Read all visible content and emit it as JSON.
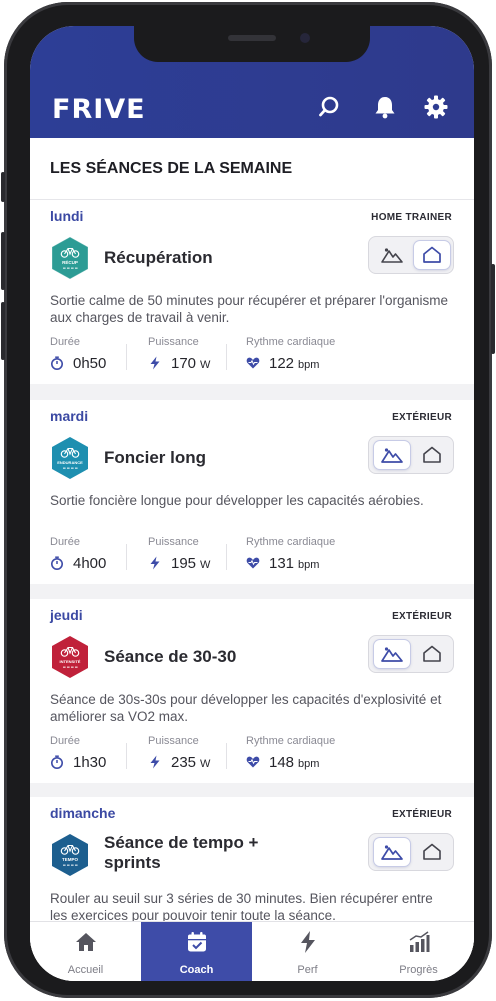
{
  "app": {
    "logo": "FRIVE",
    "accent": "#2e3d92"
  },
  "header_icons": [
    "search-icon",
    "bell-icon",
    "gear-icon"
  ],
  "section": {
    "title": "LES SÉANCES DE LA SEMAINE"
  },
  "stat_labels": {
    "duration": "Durée",
    "power": "Puissance",
    "heart": "Rythme cardiaque"
  },
  "units": {
    "power": "W",
    "heart": "bpm"
  },
  "sessions": [
    {
      "day": "lundi",
      "environment": "HOME TRAINER",
      "badge_label": "RÉCUP",
      "badge_color": "#2c9c95",
      "title": "Récupération",
      "selected_mode": "indoor",
      "description": "Sortie calme de 50 minutes pour récupérer et préparer l'organisme aux charges de travail à venir.",
      "duration": "0h50",
      "power": "170",
      "heart_rate": "122"
    },
    {
      "day": "mardi",
      "environment": "EXTÉRIEUR",
      "badge_label": "ENDURANCE",
      "badge_color": "#1e8fb0",
      "title": "Foncier long",
      "selected_mode": "outdoor",
      "description": "Sortie foncière longue pour développer les capacités aérobies.",
      "duration": "4h00",
      "power": "195",
      "heart_rate": "131"
    },
    {
      "day": "jeudi",
      "environment": "EXTÉRIEUR",
      "badge_label": "INTENSITÉ",
      "badge_color": "#c0213a",
      "title": "Séance de 30-30",
      "selected_mode": "outdoor",
      "description": "Séance de 30s-30s pour développer les capacités d'explosivité et améliorer sa VO2 max.",
      "duration": "1h30",
      "power": "235",
      "heart_rate": "148"
    },
    {
      "day": "dimanche",
      "environment": "EXTÉRIEUR",
      "badge_label": "TEMPO",
      "badge_color": "#1d5f8f",
      "title": "Séance de tempo + sprints",
      "selected_mode": "outdoor",
      "description": "Rouler au seuil sur 3 séries de 30 minutes. Bien récupérer entre les exercices pour pouvoir tenir toute la séance.",
      "duration": "",
      "power": "",
      "heart_rate": ""
    }
  ],
  "tabs": [
    {
      "label": "Accueil",
      "icon": "home-icon",
      "active": false
    },
    {
      "label": "Coach",
      "icon": "calendar-check-icon",
      "active": true
    },
    {
      "label": "Perf",
      "icon": "lightning-icon",
      "active": false
    },
    {
      "label": "Progrès",
      "icon": "bar-chart-icon",
      "active": false
    }
  ]
}
